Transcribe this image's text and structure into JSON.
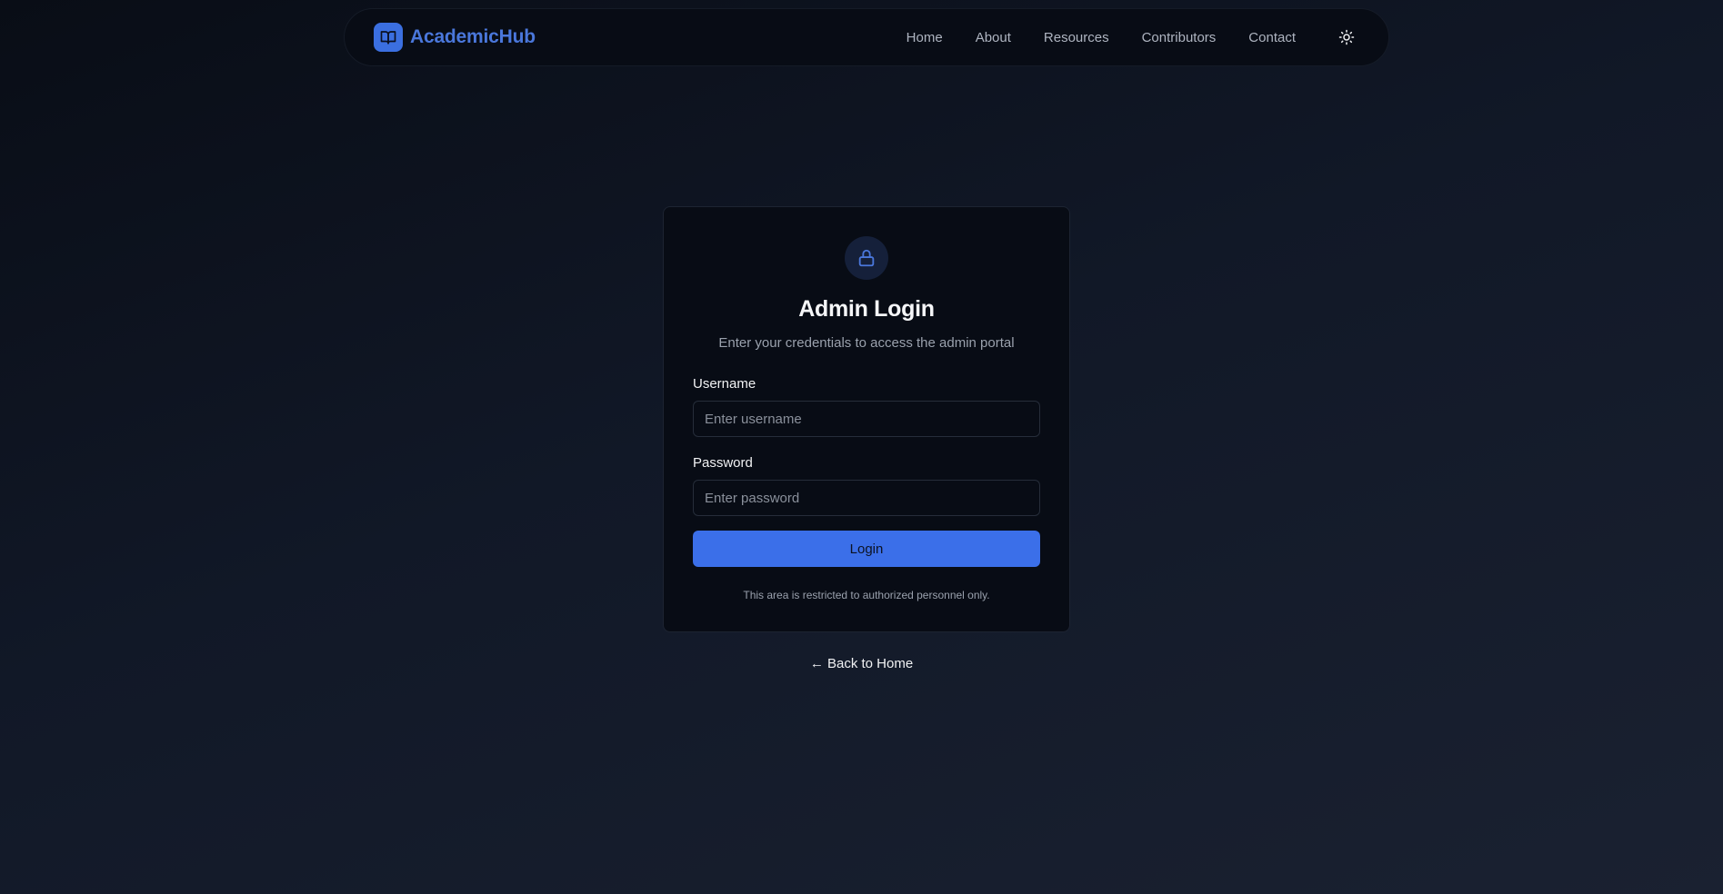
{
  "nav": {
    "brand": "AcademicHub",
    "links": [
      "Home",
      "About",
      "Resources",
      "Contributors",
      "Contact"
    ],
    "theme_toggle_icon": "sun-icon"
  },
  "login": {
    "icon": "lock-icon",
    "title": "Admin Login",
    "subtitle": "Enter your credentials to access the admin portal",
    "username_label": "Username",
    "username_placeholder": "Enter username",
    "username_value": "",
    "password_label": "Password",
    "password_placeholder": "Enter password",
    "password_value": "",
    "submit_label": "Login",
    "notice": "This area is restricted to authorized personnel only."
  },
  "back_link": "← Back to Home",
  "colors": {
    "accent": "#3b6fe9",
    "brand_text": "#4a77db",
    "background": "#0d1320",
    "card": "#080c15"
  }
}
